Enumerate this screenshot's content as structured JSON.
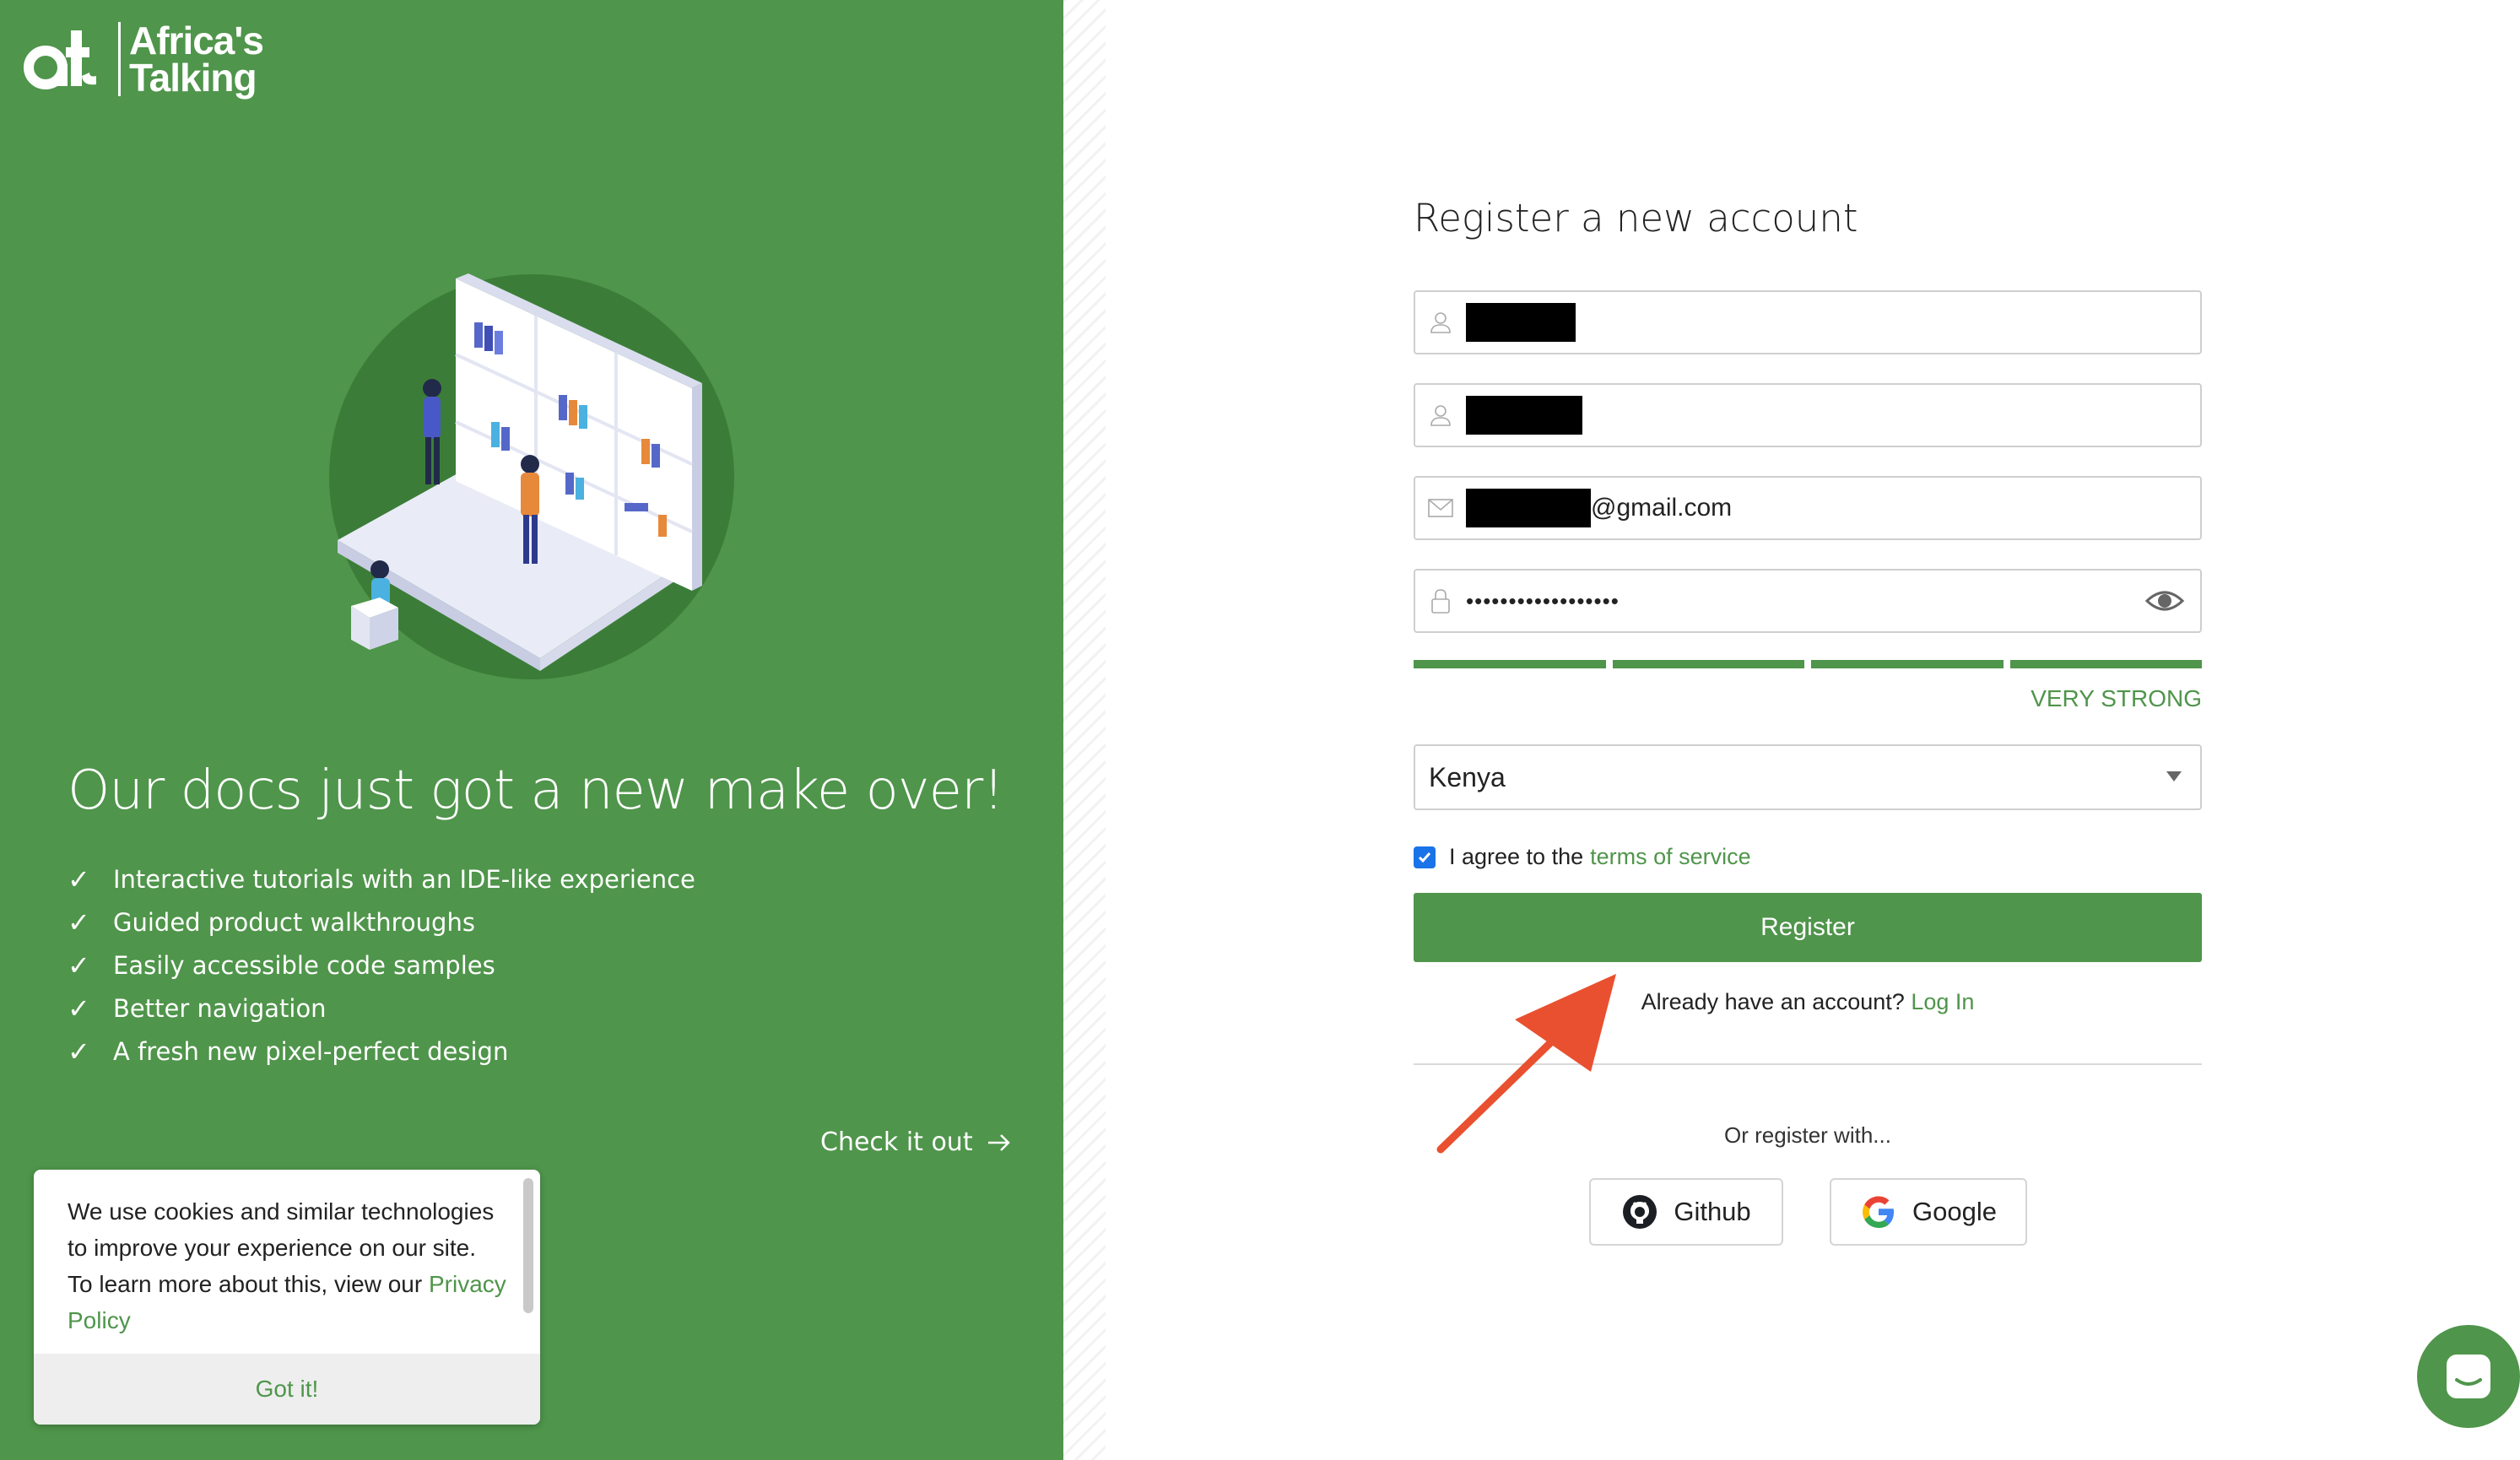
{
  "brand": {
    "logo_mark": "at",
    "logo_line1": "Africa's",
    "logo_line2": "Talking"
  },
  "promo": {
    "headline": "Our docs just got a new make over!",
    "features": [
      "Interactive tutorials with an IDE-like experience",
      "Guided product walkthroughs",
      "Easily accessible code samples",
      "Better navigation",
      "A fresh new pixel-perfect design"
    ],
    "cta": "Check it out"
  },
  "cookie": {
    "text": "We use cookies and similar technologies to improve your experience on our site. To learn more about this, view our",
    "link": "Privacy Policy",
    "button": "Got it!"
  },
  "form": {
    "title": "Register a new account",
    "email_suffix": "@gmail.com",
    "password_masked": "••••••••••••••••••",
    "strength_label": "VERY STRONG",
    "strength_level": 4,
    "strength_max": 4,
    "country": "Kenya",
    "agree_checked": true,
    "agree_text": "I agree to the",
    "terms_link": "terms of service",
    "register_label": "Register",
    "login_prompt": "Already have an account?",
    "login_link": "Log In",
    "or_text": "Or register with...",
    "github_label": "Github",
    "google_label": "Google"
  },
  "colors": {
    "brand_green": "#4f954b",
    "annotation_red": "#e9502f",
    "checkbox_blue": "#1a73e8"
  },
  "icons": [
    "user-icon",
    "user-icon",
    "envelope-icon",
    "lock-icon",
    "eye-icon",
    "github-icon",
    "google-icon",
    "chat-icon",
    "arrow-right-icon",
    "check-icon"
  ]
}
